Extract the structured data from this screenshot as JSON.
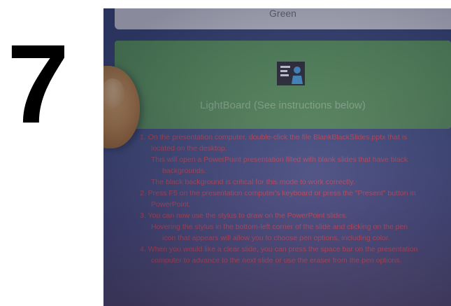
{
  "step": {
    "number": "7"
  },
  "screen": {
    "top_button_label": "Green",
    "card_title": "LightBoard (See instructions below)",
    "card_icon": "lightboard-presenter-icon",
    "colors": {
      "card_green": "#5fa055",
      "instruction_red": "#e8484a",
      "screen_blue": "#44507e"
    },
    "instructions": [
      {
        "level": 1,
        "text": "1. On the presentation computer, double-click the file BlankBlackSlides.pptx that is"
      },
      {
        "level": 1,
        "text": "located on the desktop."
      },
      {
        "level": 2,
        "text": "This will open a PowerPoint presentation filled with blank slides that have black"
      },
      {
        "level": 3,
        "text": "backgrounds."
      },
      {
        "level": 2,
        "text": "The black background is critical for this mode to work correctly."
      },
      {
        "level": 1,
        "text": "2. Press F5 on the presentation computer's keyboard or press the \"Present\" button in"
      },
      {
        "level": 1,
        "text": "PowerPoint."
      },
      {
        "level": 1,
        "text": "3. You can now use the stylus to draw on the PowerPoint slides."
      },
      {
        "level": 2,
        "text": "Hovering the stylus in the bottom-left corner of the slide and clicking on the pen"
      },
      {
        "level": 3,
        "text": "icon that appears will allow you to choose pen options, including color."
      },
      {
        "level": 1,
        "text": "4. When you would like a clear slide, you can press the space bar on the presentation"
      },
      {
        "level": 1,
        "text": "computer to advance to the next slide or use the eraser from the pen options."
      }
    ]
  }
}
